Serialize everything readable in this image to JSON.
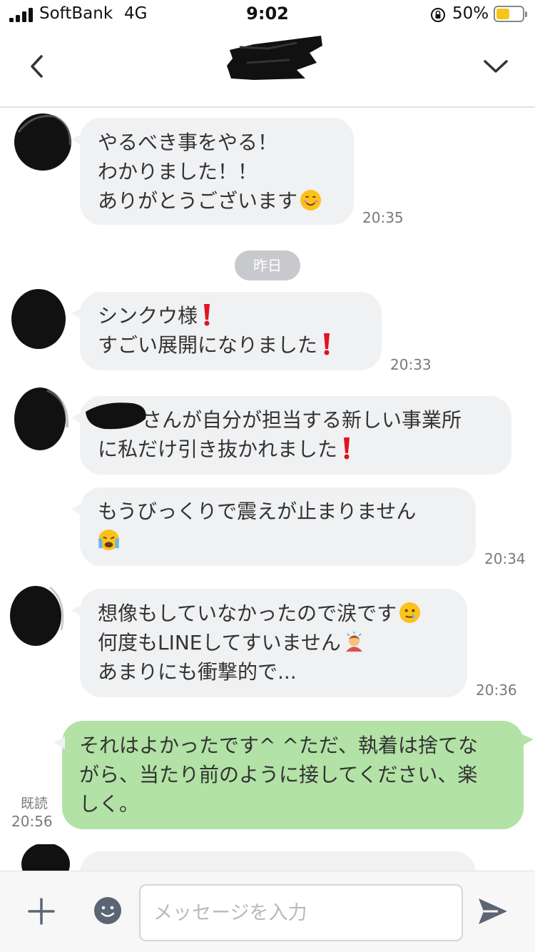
{
  "status_bar": {
    "carrier": "SoftBank",
    "network": "4G",
    "time": "9:02",
    "battery_text": "50%",
    "battery_level": 0.5,
    "battery_color": "#f5c518"
  },
  "header": {
    "back_icon": "chevron-left-icon",
    "menu_icon": "chevron-down-icon"
  },
  "messages": [
    {
      "lines": [
        "やるべき事をやる！",
        "わかりました！！",
        "ありがとうございます"
      ],
      "time": "20:35"
    },
    {
      "date_divider": "昨日"
    },
    {
      "lines": [
        "シンクウ様",
        "すごい展開になりました"
      ],
      "time": "20:33"
    },
    {
      "lines": [
        "さんが自分が担当する新しい事業所",
        "に私だけ引き抜かれました"
      ]
    },
    {
      "lines": [
        "もうびっくりで震えが止まりません"
      ],
      "time": "20:34"
    },
    {
      "lines": [
        "想像もしていなかったので涙です",
        "何度もLINEしてすいません",
        "あまりにも衝撃的で..."
      ],
      "time": "20:36"
    },
    {
      "outgoing": true,
      "read_label": "既読",
      "lines": [
        "それはよかったです^ ^ただ、執着は捨てな",
        "がら、当たり前のように接してください、楽",
        "しく。"
      ],
      "time": "20:56"
    }
  ],
  "input": {
    "placeholder": "メッセージを入力"
  },
  "colors": {
    "incoming_bubble": "#f0f1f3",
    "outgoing_bubble": "#b2e2a6",
    "date_pill": "#c8c9cc"
  }
}
